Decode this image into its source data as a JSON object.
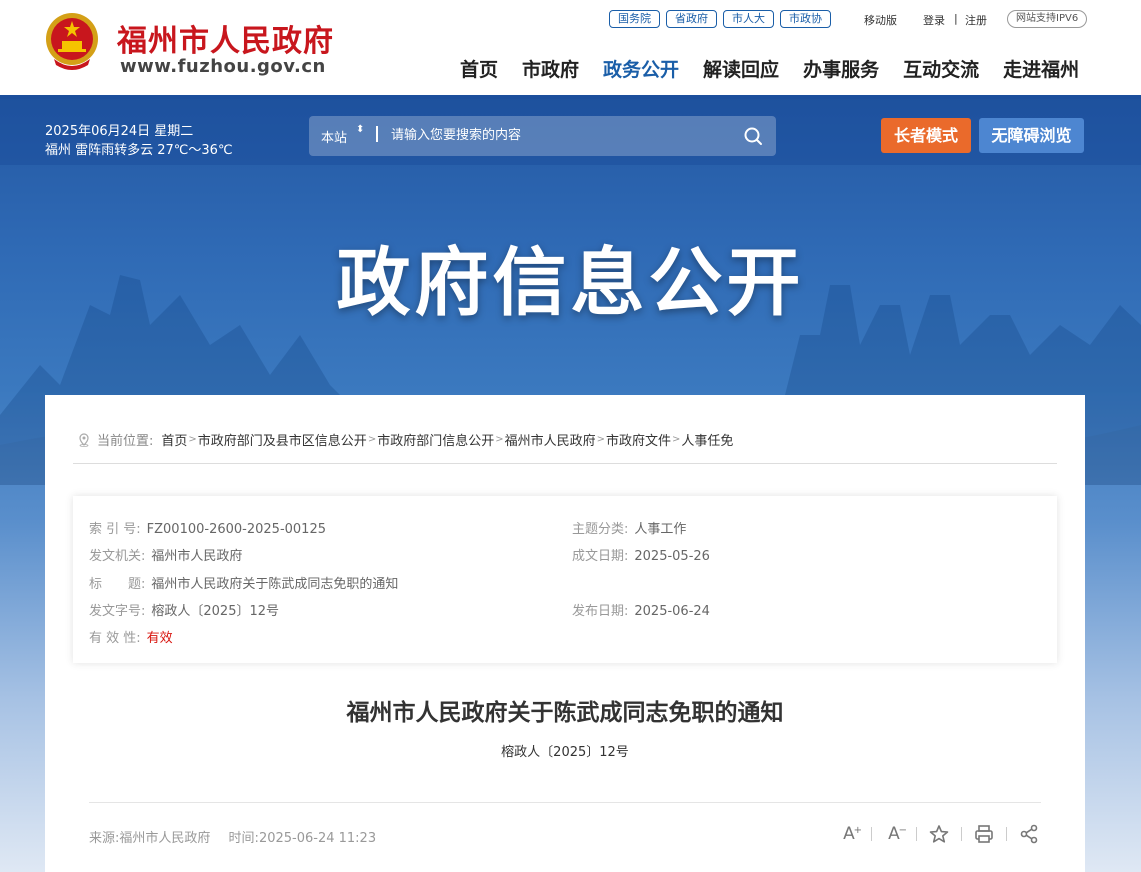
{
  "header": {
    "site_name": "福州市人民政府",
    "site_url": "www.fuzhou.gov.cn",
    "top_links": [
      "国务院",
      "省政府",
      "市人大",
      "市政协"
    ],
    "mobile": "移动版",
    "login": "登录",
    "divider": "|",
    "register": "注册",
    "ipv6": "网站支持IPV6",
    "nav": [
      "首页",
      "市政府",
      "政务公开",
      "解读回应",
      "办事服务",
      "互动交流",
      "走进福州"
    ],
    "active_nav": "政务公开"
  },
  "infobar": {
    "date": "2025年06月24日 星期二",
    "weather": "福州 雷阵雨转多云 27℃～36℃",
    "search_scope": "本站",
    "search_arrow": "⬍",
    "search_placeholder": "请输入您要搜索的内容",
    "elder_mode": "长者模式",
    "accessible": "无障碍浏览"
  },
  "hero": {
    "title": "政府信息公开"
  },
  "breadcrumb": {
    "label": "当前位置:",
    "items": [
      "首页",
      "市政府部门及县市区信息公开",
      "市政府部门信息公开",
      "福州市人民政府",
      "市政府文件",
      "人事任免"
    ],
    "separator": ">"
  },
  "meta": {
    "index_label": "索 引 号:",
    "index_value": "FZ00100-2600-2025-00125",
    "topic_label": "主题分类:",
    "topic_value": "人事工作",
    "issuer_label": "发文机关:",
    "issuer_value": "福州市人民政府",
    "created_label": "成文日期:",
    "created_value": "2025-05-26",
    "title_label": "标　　题:",
    "title_value": "福州市人民政府关于陈武成同志免职的通知",
    "docno_label": "发文字号:",
    "docno_value": "榕政人〔2025〕12号",
    "published_label": "发布日期:",
    "published_value": "2025-06-24",
    "validity_label": "有 效 性:",
    "validity_value": "有效",
    "validity_color": "#d8140e"
  },
  "document": {
    "title": "福州市人民政府关于陈武成同志免职的通知",
    "number": "榕政人〔2025〕12号",
    "source_label": "来源:",
    "source_value": "福州市人民政府",
    "time_label": "时间:",
    "time_value": "2025-06-24 11:23"
  },
  "tools": {
    "font_larger_glyph": "A",
    "font_larger_mark": "+",
    "font_smaller_glyph": "A",
    "font_smaller_mark": "−",
    "icons": [
      "font-larger-icon",
      "font-smaller-icon",
      "star-icon",
      "print-icon",
      "share-icon"
    ]
  },
  "colors": {
    "brand_red": "#c8161d",
    "brand_blue": "#1a5ea8",
    "elder_orange": "#ea6a2b",
    "access_blue": "#4d86d1"
  }
}
